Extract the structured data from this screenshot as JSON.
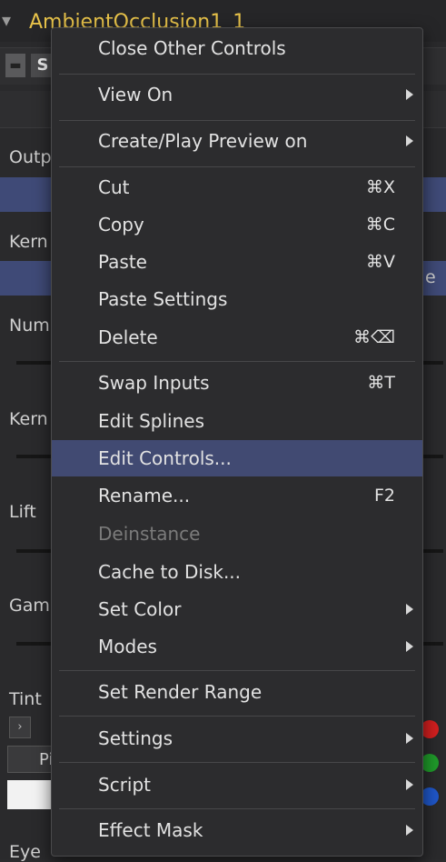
{
  "window": {
    "title": "AmbientOcclusion1_1",
    "toolbar_button": "S"
  },
  "inspector": {
    "labels": [
      "Outp",
      "Kern",
      "Num",
      "Kern",
      "Lift",
      "Gam",
      "Tint",
      "Eye"
    ],
    "right_fragment": "e",
    "pick_button": "Pi",
    "expand_icon": "chevron-right-icon"
  },
  "colors": {
    "menu_bg": "#2c2c2e",
    "highlight": "#414a72",
    "title": "#e8c34a",
    "red": "#d21f1f",
    "green": "#1f9a2a",
    "blue": "#1f56c8"
  },
  "menu": {
    "items": [
      {
        "label": "Close Other Controls",
        "shortcut": "",
        "submenu": false,
        "disabled": false,
        "highlighted": false
      },
      {
        "label": "View On",
        "shortcut": "",
        "submenu": true,
        "disabled": false,
        "highlighted": false
      },
      {
        "label": "Create/Play Preview on",
        "shortcut": "",
        "submenu": true,
        "disabled": false,
        "highlighted": false
      },
      {
        "label": "Cut",
        "shortcut": "⌘X",
        "submenu": false,
        "disabled": false,
        "highlighted": false
      },
      {
        "label": "Copy",
        "shortcut": "⌘C",
        "submenu": false,
        "disabled": false,
        "highlighted": false
      },
      {
        "label": "Paste",
        "shortcut": "⌘V",
        "submenu": false,
        "disabled": false,
        "highlighted": false
      },
      {
        "label": "Paste Settings",
        "shortcut": "",
        "submenu": false,
        "disabled": false,
        "highlighted": false
      },
      {
        "label": "Delete",
        "shortcut": "⌘⌫",
        "submenu": false,
        "disabled": false,
        "highlighted": false
      },
      {
        "label": "Swap Inputs",
        "shortcut": "⌘T",
        "submenu": false,
        "disabled": false,
        "highlighted": false
      },
      {
        "label": "Edit Splines",
        "shortcut": "",
        "submenu": false,
        "disabled": false,
        "highlighted": false
      },
      {
        "label": "Edit Controls...",
        "shortcut": "",
        "submenu": false,
        "disabled": false,
        "highlighted": true
      },
      {
        "label": "Rename...",
        "shortcut": "F2",
        "submenu": false,
        "disabled": false,
        "highlighted": false
      },
      {
        "label": "Deinstance",
        "shortcut": "",
        "submenu": false,
        "disabled": true,
        "highlighted": false
      },
      {
        "label": "Cache to Disk...",
        "shortcut": "",
        "submenu": false,
        "disabled": false,
        "highlighted": false
      },
      {
        "label": "Set Color",
        "shortcut": "",
        "submenu": true,
        "disabled": false,
        "highlighted": false
      },
      {
        "label": "Modes",
        "shortcut": "",
        "submenu": true,
        "disabled": false,
        "highlighted": false
      },
      {
        "label": "Set Render Range",
        "shortcut": "",
        "submenu": false,
        "disabled": false,
        "highlighted": false
      },
      {
        "label": "Settings",
        "shortcut": "",
        "submenu": true,
        "disabled": false,
        "highlighted": false
      },
      {
        "label": "Script",
        "shortcut": "",
        "submenu": true,
        "disabled": false,
        "highlighted": false
      },
      {
        "label": "Effect Mask",
        "shortcut": "",
        "submenu": true,
        "disabled": false,
        "highlighted": false
      }
    ]
  }
}
